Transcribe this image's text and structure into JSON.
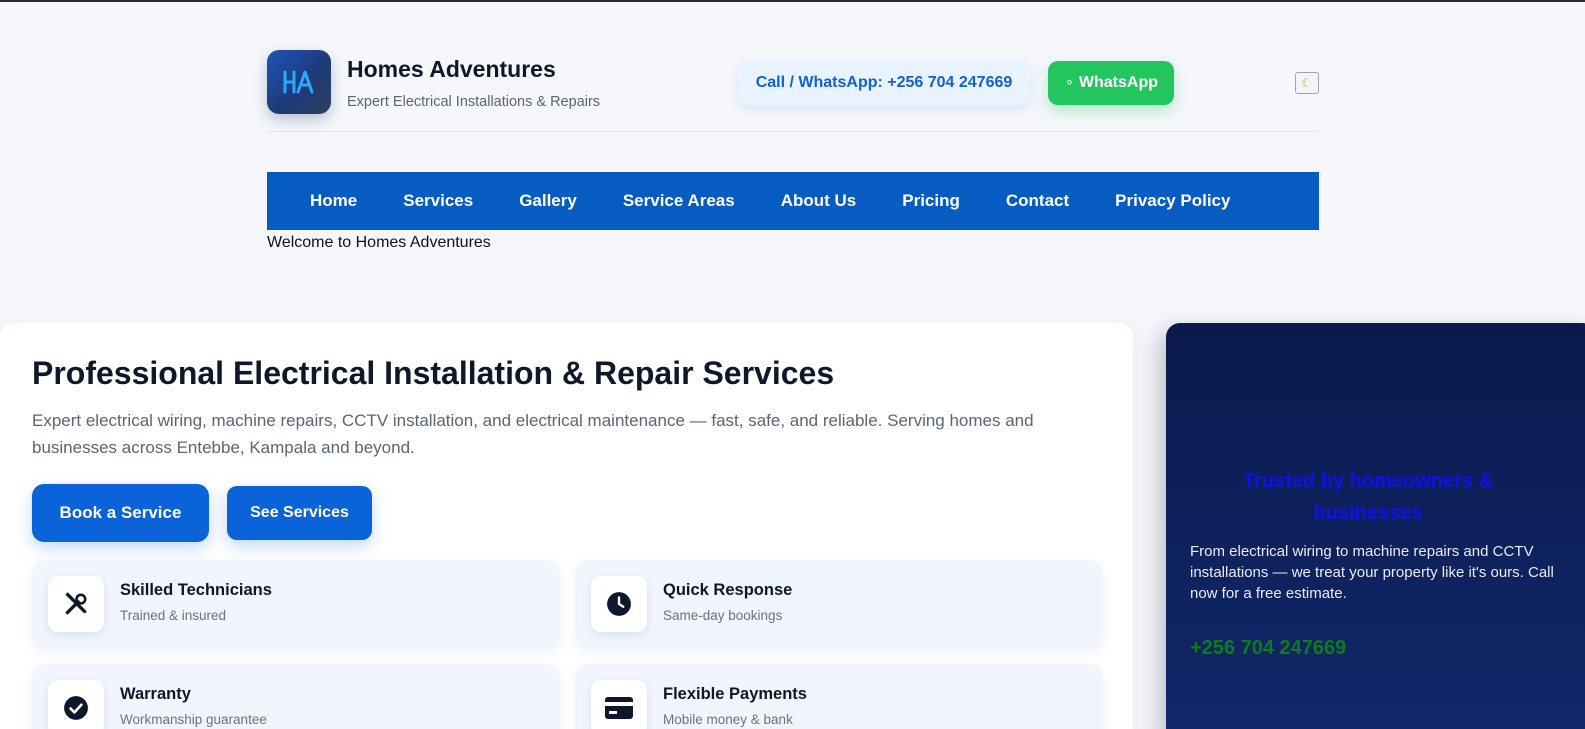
{
  "header": {
    "logo_text": "HA",
    "brand_name": "Homes Adventures",
    "tagline": "Expert Electrical Installations & Repairs",
    "call_label": "Call / WhatsApp: +256 704 247669",
    "whatsapp_label": "WhatsApp",
    "whatsapp_icon": "whatsapp-icon",
    "theme_toggle_icon": "moon-icon"
  },
  "nav": {
    "items": [
      {
        "label": "Home"
      },
      {
        "label": "Services"
      },
      {
        "label": "Gallery"
      },
      {
        "label": "Service Areas"
      },
      {
        "label": "About Us"
      },
      {
        "label": "Pricing"
      },
      {
        "label": "Contact"
      },
      {
        "label": "Privacy Policy"
      }
    ]
  },
  "welcome": "Welcome to Homes Adventures",
  "hero": {
    "title": "Professional Electrical Installation & Repair Services",
    "description": "Expert electrical wiring, machine repairs, CCTV installation, and electrical maintenance — fast, safe, and reliable. Serving homes and businesses across Entebbe, Kampala and beyond.",
    "book_label": "Book a Service",
    "see_label": "See Services",
    "features": [
      {
        "title": "Skilled Technicians",
        "subtitle": "Trained & insured",
        "icon": "tools-icon"
      },
      {
        "title": "Quick Response",
        "subtitle": "Same-day bookings",
        "icon": "clock-icon"
      },
      {
        "title": "Warranty",
        "subtitle": "Workmanship guarantee",
        "icon": "check-circle-icon"
      },
      {
        "title": "Flexible Payments",
        "subtitle": "Mobile money & bank",
        "icon": "credit-card-icon"
      }
    ]
  },
  "trust": {
    "title": "Trusted by homeowners & businesses",
    "description": "From electrical wiring to machine repairs and CCTV installations — we treat your property like it's ours. Call now for a free estimate.",
    "phone": "+256 704 247669"
  },
  "colors": {
    "primary": "#075cc1",
    "button": "#0a63d8",
    "whatsapp": "#22c55e",
    "dark_card": "#0b1a4e"
  }
}
